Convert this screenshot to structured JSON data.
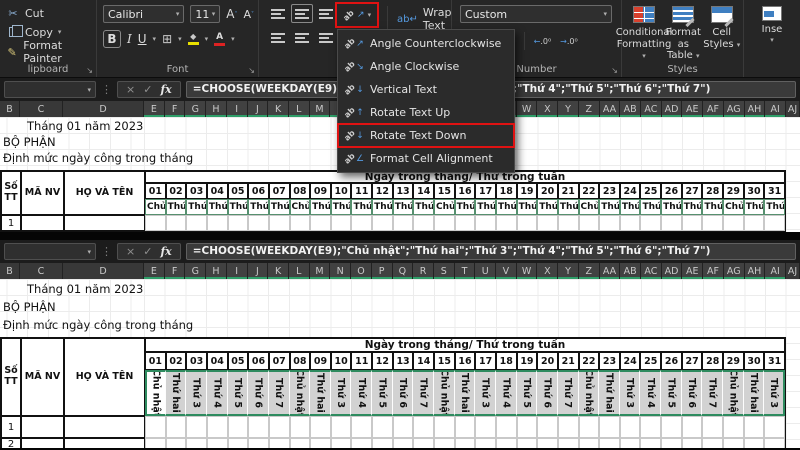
{
  "colors": {
    "highlight_red": "#e01212",
    "selection_green": "#2e8b5f",
    "header_underline_green": "#2e9e68",
    "selection_gray_fill": "#d2d2d2",
    "menu_icon_blue": "#559ae0"
  },
  "ribbon": {
    "clipboard": {
      "cut": "Cut",
      "copy": "Copy",
      "format_painter": "Format Painter",
      "group_label": "lipboard"
    },
    "font": {
      "font_name": "Calibri",
      "font_size": "11",
      "group_label": "Font",
      "bold": "B",
      "italic": "I",
      "underline": "U"
    },
    "alignment": {
      "wrap_text": "Wrap Text"
    },
    "number": {
      "format": "Custom",
      "percent": "%",
      "comma": ",",
      "group_label": "Number"
    },
    "styles": {
      "conditional_1": "Conditional",
      "conditional_2": "Formatting",
      "table_1": "Format as",
      "table_2": "Table",
      "cell_1": "Cell",
      "cell_2": "Styles",
      "group_label": "Styles"
    },
    "insert": {
      "label": "Inse"
    }
  },
  "orientation_menu": {
    "items": [
      {
        "label": "Angle Counterclockwise",
        "icon": "angle-counterclockwise-icon",
        "glyph": "↗",
        "highlighted": false
      },
      {
        "label": "Angle Clockwise",
        "icon": "angle-clockwise-icon",
        "glyph": "↘",
        "highlighted": false
      },
      {
        "label": "Vertical Text",
        "icon": "vertical-text-icon",
        "glyph": "↓",
        "highlighted": false
      },
      {
        "label": "Rotate Text Up",
        "icon": "rotate-text-up-icon",
        "glyph": "↑",
        "highlighted": false
      },
      {
        "label": "Rotate Text Down",
        "icon": "rotate-text-down-icon",
        "glyph": "↓",
        "highlighted": true
      },
      {
        "label": "Format Cell Alignment",
        "icon": "format-cell-alignment-icon",
        "glyph": "∠",
        "highlighted": false
      }
    ]
  },
  "formula_bar": {
    "formula": "=CHOOSE(WEEKDAY(E9);\"Chủ nhật\";\"Thứ hai\";\"Thứ 3\";\"Thứ 4\";\"Thứ 5\";\"Thứ 6\";\"Thứ 7\")",
    "fx_label": "fx",
    "cancel": "×",
    "enter": "✓"
  },
  "columns": [
    "B",
    "C",
    "D",
    "E",
    "F",
    "G",
    "H",
    "I",
    "J",
    "K",
    "L",
    "M",
    "N",
    "O",
    "P",
    "Q",
    "R",
    "S",
    "T",
    "U",
    "V",
    "W",
    "X",
    "Y",
    "Z",
    "AA",
    "AB",
    "AC",
    "AD",
    "AE",
    "AF",
    "AG",
    "AH",
    "AI",
    "AJ"
  ],
  "sheet": {
    "month_title": "Tháng 01 năm 2023",
    "line2": "BỘ PHẬN",
    "line3": "Định mức ngày công trong tháng",
    "table": {
      "col_stt": "Số TT",
      "col_manv": "MÃ NV",
      "col_name": "HỌ VÀ TÊN",
      "days_header": "Ngày trong tháng/ Thứ trong tuần",
      "days": [
        "01",
        "02",
        "03",
        "04",
        "05",
        "06",
        "07",
        "08",
        "09",
        "10",
        "11",
        "12",
        "13",
        "14",
        "15",
        "16",
        "17",
        "18",
        "19",
        "20",
        "21",
        "22",
        "23",
        "24",
        "25",
        "26",
        "27",
        "28",
        "29",
        "30",
        "31"
      ],
      "day_names": [
        "Chủ nhật",
        "Thứ hai",
        "Thứ 3",
        "Thứ 4",
        "Thứ 5",
        "Thứ 6",
        "Thứ 7",
        "Chủ nhật",
        "Thứ hai",
        "Thứ 3",
        "Thứ 4",
        "Thứ 5",
        "Thứ 6",
        "Thứ 7",
        "Chủ nhật",
        "Thứ hai",
        "Thứ 3",
        "Thứ 4",
        "Thứ 5",
        "Thứ 6",
        "Thứ 7",
        "Chủ nhật",
        "Thứ hai",
        "Thứ 3",
        "Thứ 4",
        "Thứ 5",
        "Thứ 6",
        "Thứ 7",
        "Chủ nhật",
        "Thứ hai",
        "Thứ 3"
      ],
      "row_numbers": [
        "1",
        "2"
      ]
    }
  }
}
